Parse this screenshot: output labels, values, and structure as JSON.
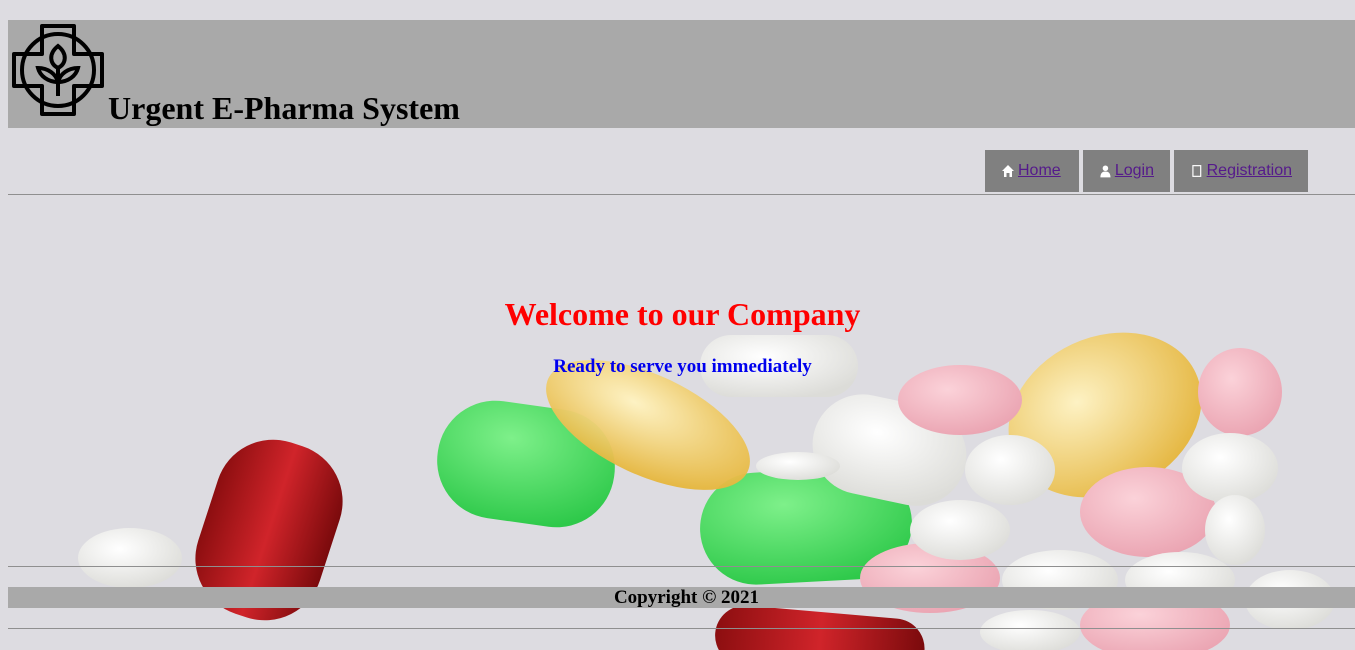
{
  "header": {
    "title": "Urgent E-Pharma System",
    "logo_icon": "cross-plant-logo"
  },
  "nav": {
    "items": [
      {
        "label": " Home",
        "icon": "home-icon"
      },
      {
        "label": " Login",
        "icon": "user-icon"
      },
      {
        "label": " Registration",
        "icon": "registration-icon"
      }
    ],
    "link_color": "#551a8b",
    "button_bg": "#808080"
  },
  "hero": {
    "heading": "Welcome to our Company",
    "subheading": "Ready to serve you immediately",
    "heading_color": "#ff0000",
    "subheading_color": "#0000ee"
  },
  "footer": {
    "copyright": "Copyright © 2021"
  }
}
